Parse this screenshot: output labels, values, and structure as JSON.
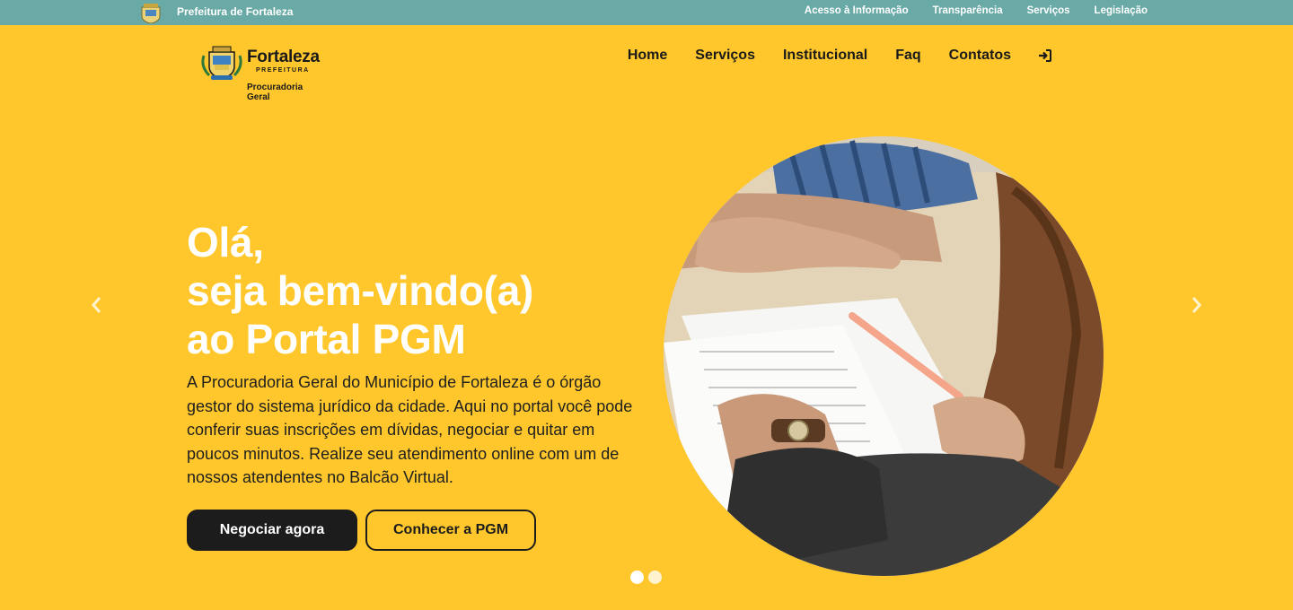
{
  "topbar": {
    "brand": "Prefeitura de Fortaleza",
    "links": [
      "Acesso à Informação",
      "Transparência",
      "Serviços",
      "Legislação"
    ]
  },
  "logo": {
    "city": "Fortaleza",
    "sub": "PREFEITURA",
    "unit_line1": "Procuradoria",
    "unit_line2": "Geral"
  },
  "nav": {
    "items": [
      "Home",
      "Serviços",
      "Institucional",
      "Faq",
      "Contatos"
    ],
    "login_icon": "sign-in-icon"
  },
  "hero": {
    "title_line1": "Olá,",
    "title_line2": "seja bem-vindo(a)",
    "title_line3": "ao Portal PGM",
    "text": "A Procuradoria Geral do Município de Fortaleza é o órgão gestor do sistema jurídico da cidade. Aqui no portal você pode conferir suas inscrições em dívidas, negociar e quitar em poucos minutos. Realize seu atendimento online com um de nossos atendentes no Balcão Virtual.",
    "primary_button": "Negociar agora",
    "secondary_button": "Conhecer a PGM"
  },
  "carousel": {
    "slide_count": 2,
    "active_slide": 1,
    "prev_icon": "chevron-left-icon",
    "next_icon": "chevron-right-icon"
  },
  "colors": {
    "background": "#ffc72c",
    "topbar": "#69aaa6",
    "dark": "#1c1c1c",
    "hero_title": "#ffffff"
  }
}
